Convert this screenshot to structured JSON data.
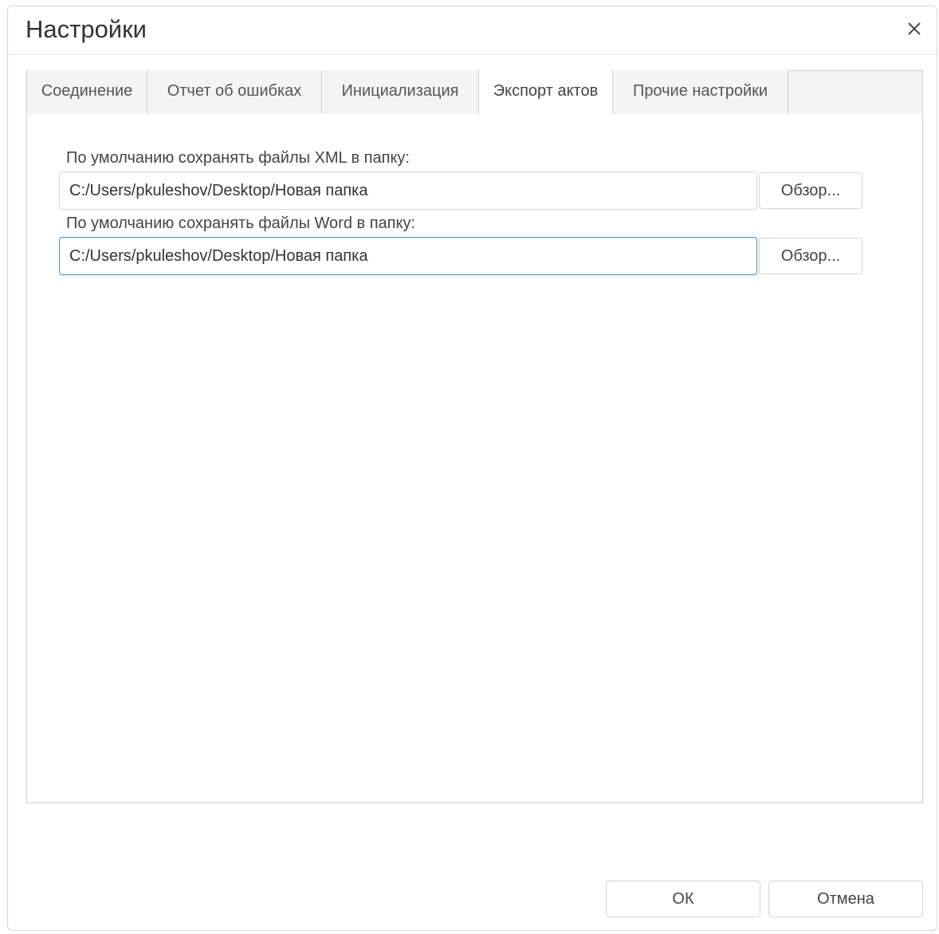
{
  "dialog": {
    "title": "Настройки",
    "close_icon": "close-icon"
  },
  "tabs": [
    {
      "label": "Соединение",
      "active": false
    },
    {
      "label": "Отчет об ошибках",
      "active": false
    },
    {
      "label": "Инициализация",
      "active": false
    },
    {
      "label": "Экспорт актов",
      "active": true
    },
    {
      "label": "Прочие настройки",
      "active": false
    }
  ],
  "export": {
    "xml_label": "По умолчанию сохранять файлы XML в папку:",
    "xml_path": "C:/Users/pkuleshov/Desktop/Новая папка",
    "word_label": "По умолчанию сохранять файлы Word в папку:",
    "word_path": "C:/Users/pkuleshov/Desktop/Новая папка",
    "browse_label": "Обзор..."
  },
  "footer": {
    "ok_label": "ОК",
    "cancel_label": "Отмена"
  },
  "colors": {
    "focus_border": "#3f8fd8",
    "border": "#cfcfcf",
    "tab_background": "#f4f4f4"
  }
}
